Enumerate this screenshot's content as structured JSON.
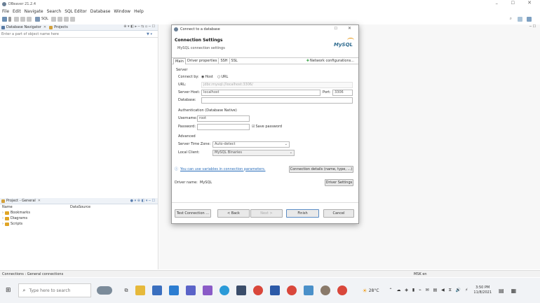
{
  "app": {
    "title": "DBeaver 21.2.4",
    "menu": [
      "File",
      "Edit",
      "Navigate",
      "Search",
      "SQL Editor",
      "Database",
      "Window",
      "Help"
    ],
    "toolbar_sql": "SQL"
  },
  "navigator": {
    "tab1": "Database Navigator",
    "tab2": "Projects",
    "filter_placeholder": "Enter a part of object name here"
  },
  "project_panel": {
    "title": "Project - General",
    "col_name": "Name",
    "col_datasource": "DataSource",
    "items": [
      "Bookmarks",
      "Diagrams",
      "Scripts"
    ]
  },
  "status_bar": {
    "left": "Connections : General connections",
    "right": "MSK  en"
  },
  "dialog": {
    "title": "Connect to a database",
    "heading": "Connection Settings",
    "subheading": "MySQL connection settings",
    "logo": "MySQL",
    "tabs": [
      "Main",
      "Driver properties",
      "SSH",
      "SSL"
    ],
    "network_link": "Network configurations...",
    "server_group": "Server",
    "connect_by_label": "Connect by:",
    "radio_host": "Host",
    "radio_url": "URL",
    "url_label": "URL:",
    "url_value": "jdbc:mysql://localhost:3306/",
    "server_host_label": "Server Host:",
    "server_host_value": "localhost",
    "port_label": "Port:",
    "port_value": "3306",
    "database_label": "Database:",
    "auth_label": "Authentication (Database Native)",
    "username_label": "Username:",
    "username_value": "root",
    "password_label": "Password:",
    "save_password": "Save password",
    "advanced_label": "Advanced",
    "timezone_label": "Server Time Zone:",
    "timezone_value": "Auto-detect",
    "local_client_label": "Local Client:",
    "local_client_value": "MySQL Binaries",
    "variables_link": "You can use variables in connection parameters.",
    "conn_details_button": "Connection details (name, type, ...)",
    "driver_label": "Driver name:",
    "driver_value": "MySQL",
    "driver_settings_button": "Driver Settings",
    "test_button": "Test Connection ...",
    "back_button": "< Back",
    "next_button": "Next >",
    "finish_button": "Finish",
    "cancel_button": "Cancel"
  },
  "taskbar": {
    "search_placeholder": "Type here to search",
    "weather": "28°C",
    "time": "3:50 PM",
    "date": "11/8/2021"
  }
}
